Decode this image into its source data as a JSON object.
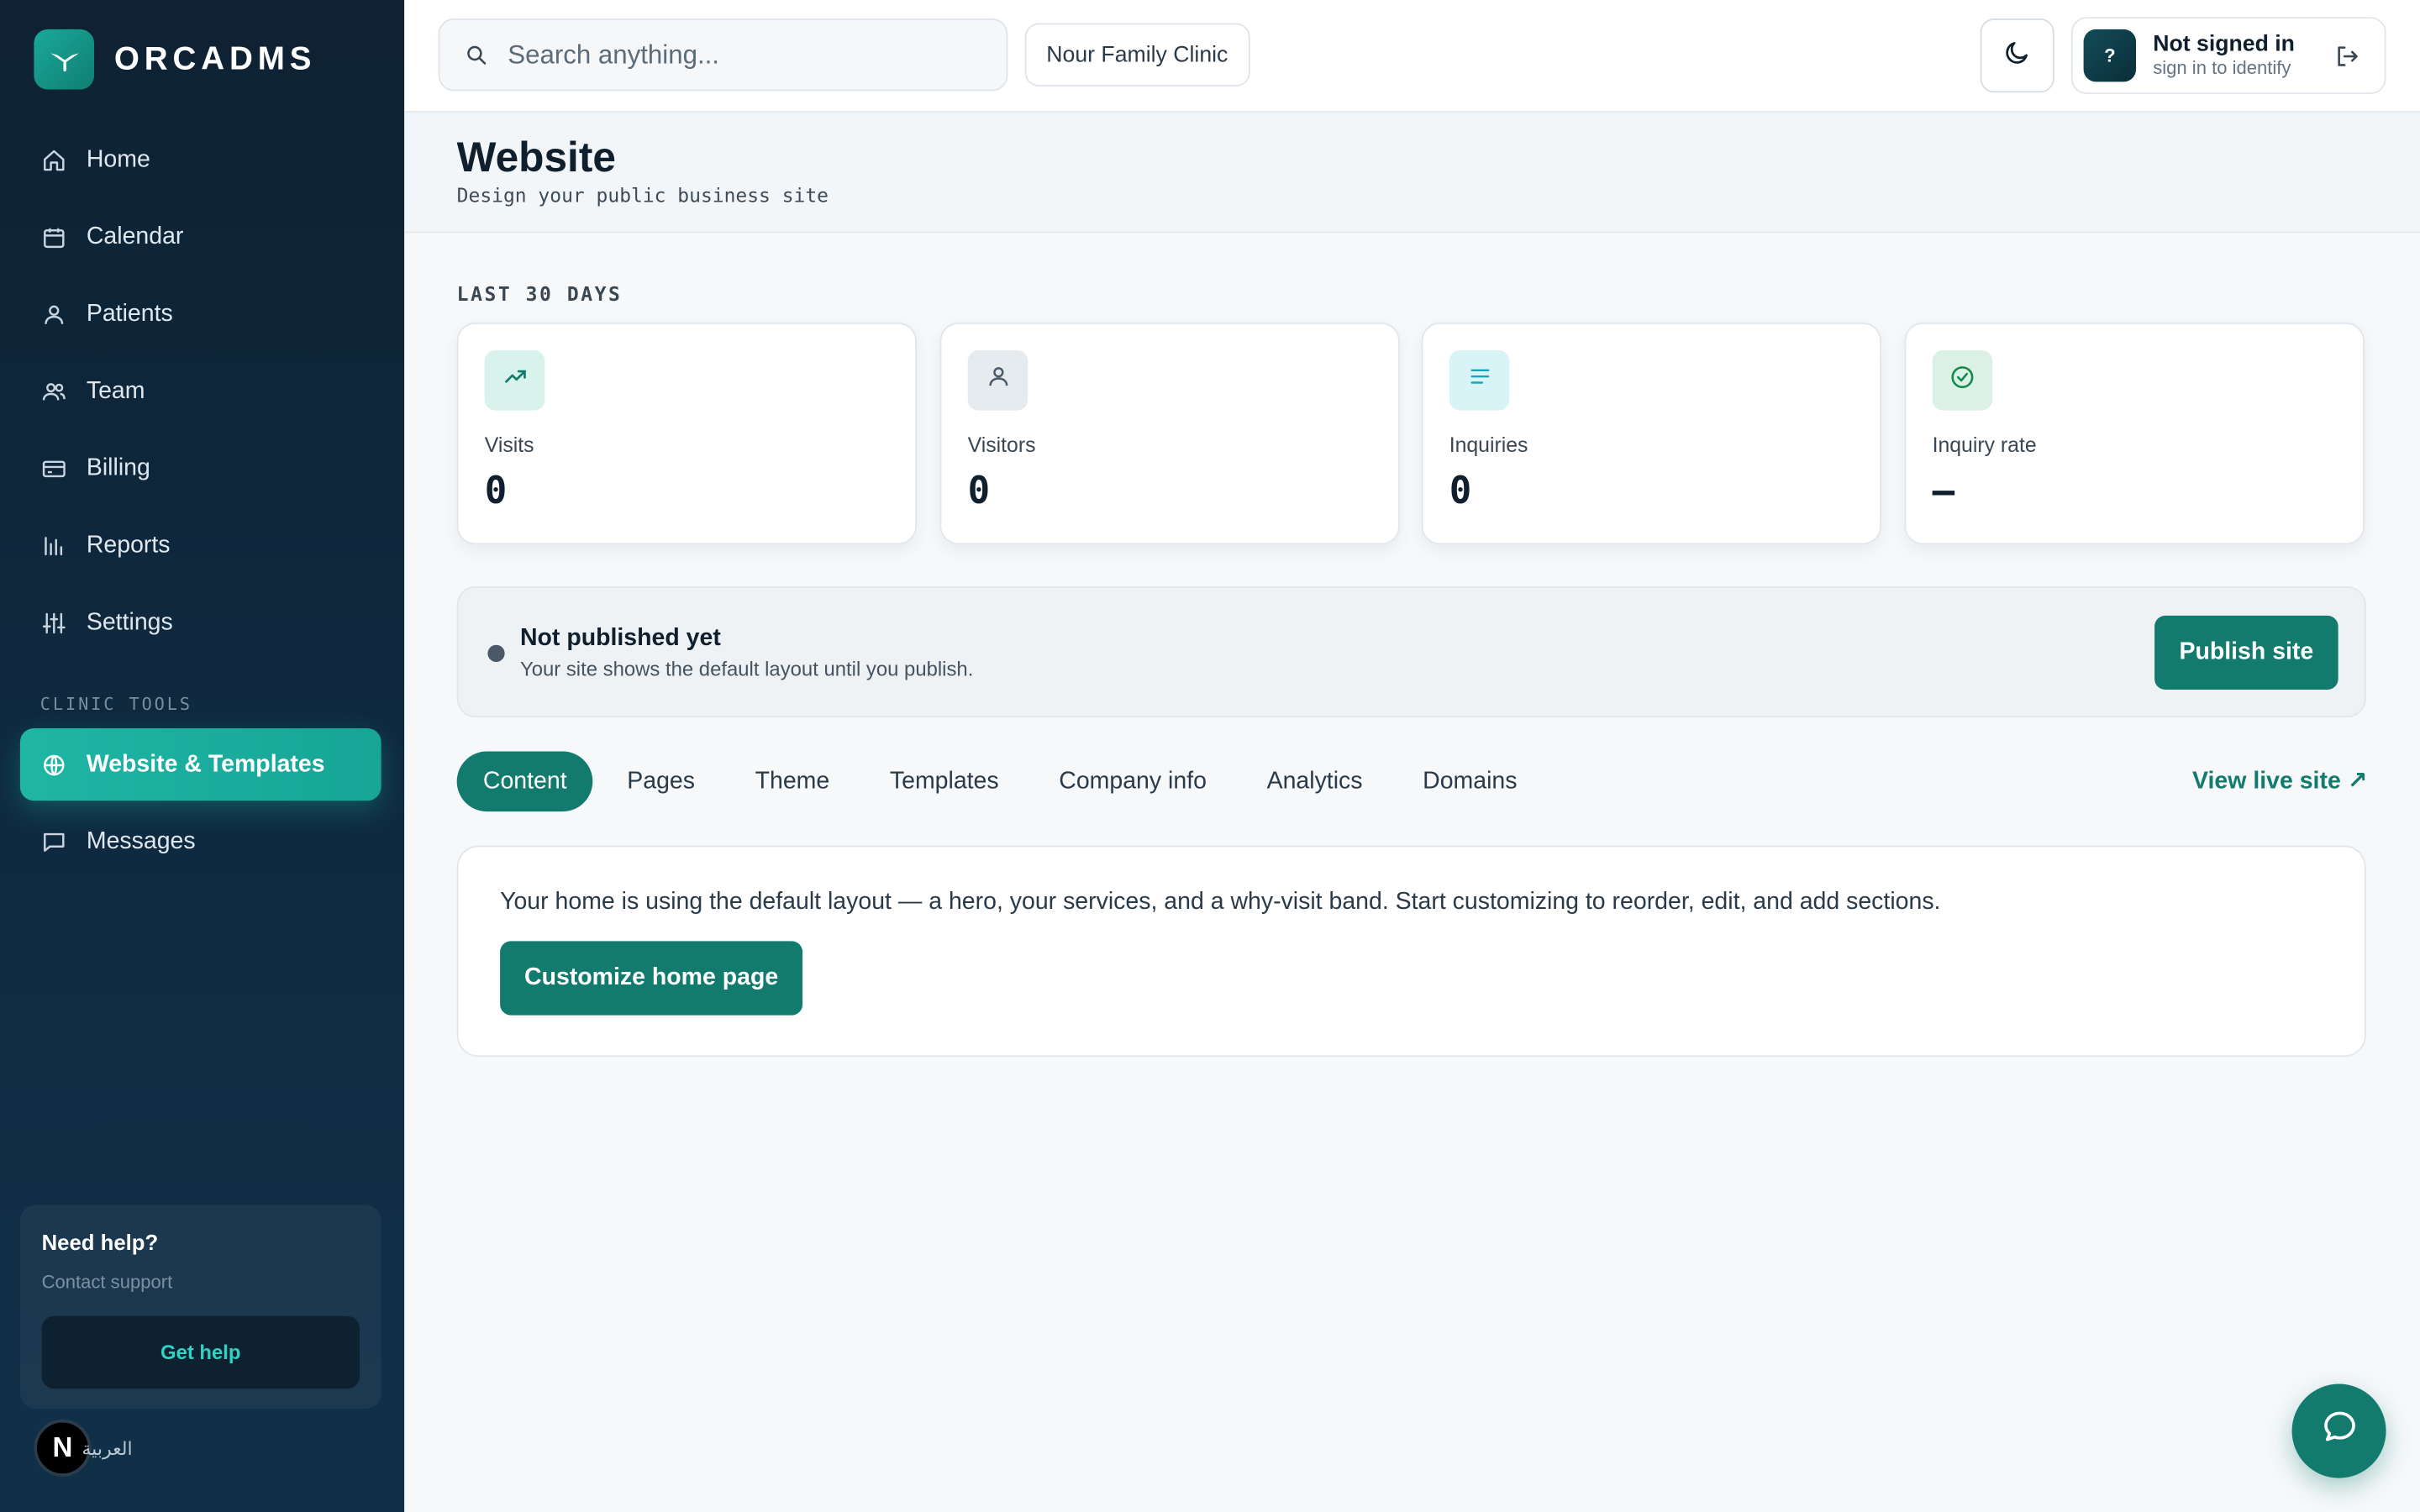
{
  "brand": {
    "name": "ORCADMS"
  },
  "sidebar": {
    "items": [
      {
        "label": "Home",
        "icon": "home-icon"
      },
      {
        "label": "Calendar",
        "icon": "calendar-icon"
      },
      {
        "label": "Patients",
        "icon": "user-icon"
      },
      {
        "label": "Team",
        "icon": "users-icon"
      },
      {
        "label": "Billing",
        "icon": "credit-card-icon"
      },
      {
        "label": "Reports",
        "icon": "bar-chart-icon"
      },
      {
        "label": "Settings",
        "icon": "sliders-icon"
      }
    ],
    "section_label": "CLINIC TOOLS",
    "active_item": {
      "label": "Website & Templates",
      "icon": "globe-icon"
    },
    "messages_item": {
      "label": "Messages",
      "icon": "message-icon"
    },
    "help": {
      "title": "Need help?",
      "subtitle": "Contact support",
      "button_label": "Get help"
    },
    "language": {
      "avatar_letter": "N",
      "label": "العربية"
    }
  },
  "topbar": {
    "search_placeholder": "Search anything...",
    "clinic_name": "Nour Family Clinic",
    "user": {
      "avatar_text": "?",
      "name": "Not signed in",
      "subtitle": "sign in to identify"
    }
  },
  "page": {
    "title": "Website",
    "subtitle": "Design your public business site"
  },
  "stats": {
    "section_label": "LAST 30 DAYS",
    "cards": [
      {
        "label": "Visits",
        "value": "0",
        "icon": "trending-up-icon",
        "badge_color": "#d7f3ec",
        "icon_color": "#137a6e"
      },
      {
        "label": "Visitors",
        "value": "0",
        "icon": "user-icon",
        "badge_color": "#e6ebf0",
        "icon_color": "#4a5868"
      },
      {
        "label": "Inquiries",
        "value": "0",
        "icon": "list-icon",
        "badge_color": "#d9f4f6",
        "icon_color": "#1aa7b5"
      },
      {
        "label": "Inquiry rate",
        "value": "—",
        "icon": "check-circle-icon",
        "badge_color": "#dcf1e5",
        "icon_color": "#138a4e"
      }
    ]
  },
  "notice": {
    "title": "Not published yet",
    "subtitle": "Your site shows the default layout until you publish.",
    "button_label": "Publish site"
  },
  "tabs": {
    "items": [
      "Content",
      "Pages",
      "Theme",
      "Templates",
      "Company info",
      "Analytics",
      "Domains"
    ],
    "active": "Content",
    "live_link": "View live site ↗"
  },
  "content": {
    "description": "Your home is using the default layout — a hero, your services, and a why-visit band. Start customizing to reorder, edit, and add sections.",
    "button_label": "Customize home page"
  },
  "colors": {
    "accent": "#137a6e",
    "sidebar_bg": "#0f2a40",
    "active_nav": "#1fb6a4"
  }
}
